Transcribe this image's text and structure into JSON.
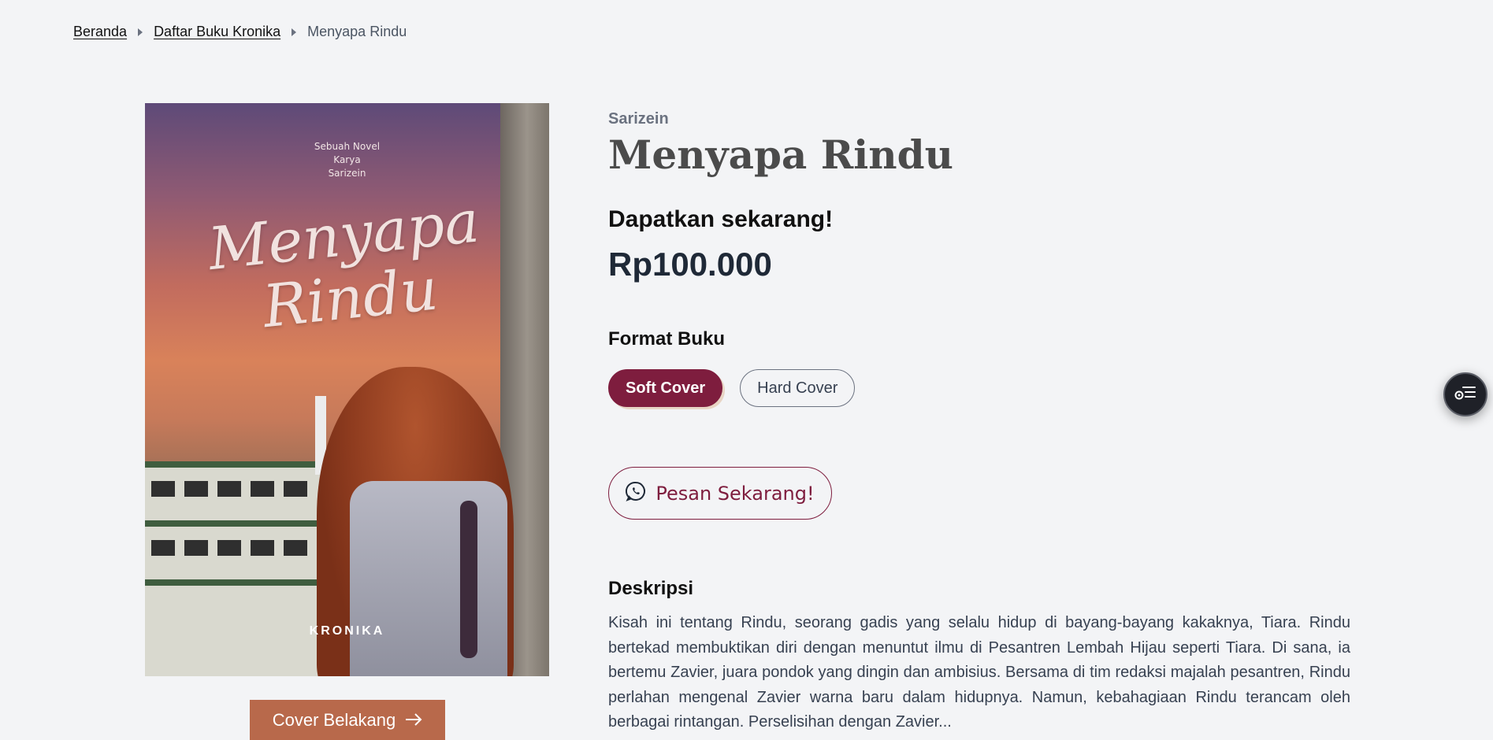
{
  "breadcrumb": {
    "home": "Beranda",
    "list": "Daftar Buku Kronika",
    "current": "Menyapa Rindu"
  },
  "cover": {
    "subtitle_line1": "Sebuah Novel",
    "subtitle_line2": "Karya",
    "subtitle_line3": "Sarizein",
    "title_line1": "Menyapa",
    "title_line2": "Rindu",
    "publisher": "KRONIKA",
    "back_button": "Cover Belakang"
  },
  "book": {
    "author": "Sarizein",
    "title": "Menyapa Rindu",
    "cta": "Dapatkan sekarang!",
    "price": "Rp100.000"
  },
  "format": {
    "heading": "Format Buku",
    "options": [
      "Soft Cover",
      "Hard Cover"
    ],
    "selected": "Soft Cover"
  },
  "order": {
    "label": "Pesan Sekarang!"
  },
  "description": {
    "heading": "Deskripsi",
    "text": "Kisah ini tentang Rindu, seorang gadis yang selalu hidup di bayang-bayang kakaknya, Tiara. Rindu bertekad membuktikan diri dengan menuntut ilmu di Pesantren Lembah Hijau seperti Tiara. Di sana, ia bertemu Zavier, juara pondok yang dingin dan ambisius. Bersama di tim redaksi majalah pesantren, Rindu perlahan mengenal Zavier warna baru dalam hidupnya. Namun, kebahagiaan Rindu terancam oleh berbagai rintangan. Perselisihan dengan Zavier..."
  },
  "colors": {
    "accent": "#7e1d3e",
    "cover_button": "#b8694b",
    "background": "#f3f4f6"
  },
  "icons": {
    "breadcrumb_separator": "chevron-right-icon",
    "cover_button": "arrow-right-icon",
    "order_button": "whatsapp-icon",
    "floating_button": "accessibility-menu-icon"
  }
}
